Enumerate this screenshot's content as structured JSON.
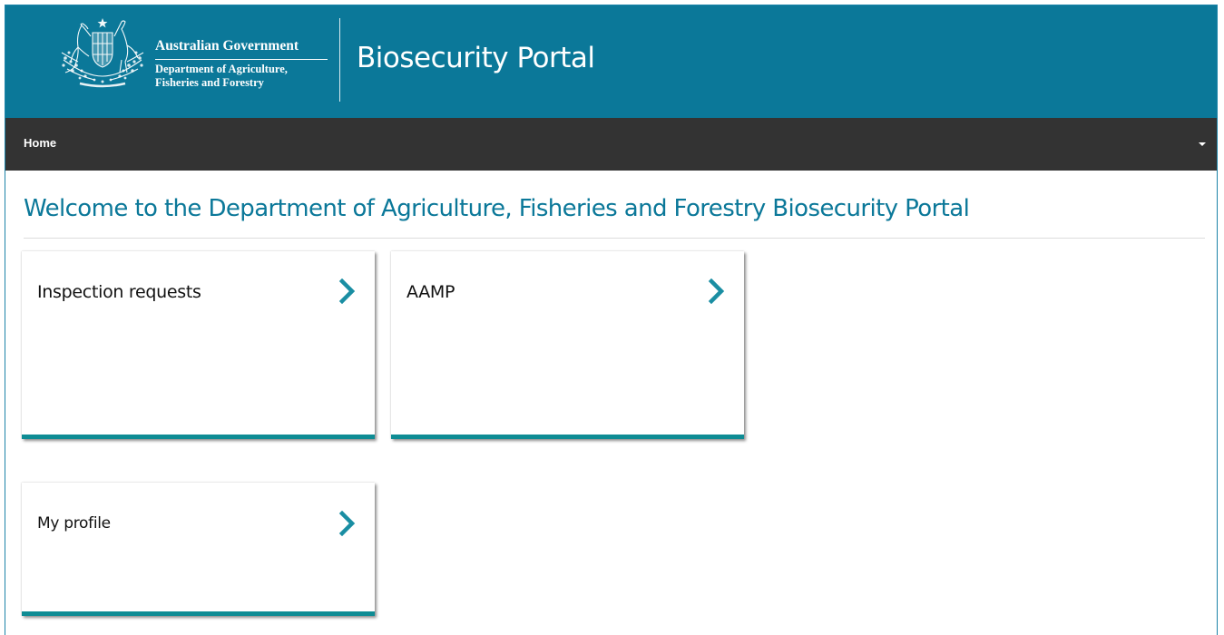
{
  "header": {
    "gov_name": "Australian Government",
    "dept_line1": "Department of Agriculture,",
    "dept_line2": "Fisheries and Forestry",
    "portal_title": "Biosecurity Portal",
    "crest_icon": "coat-of-arms-icon",
    "background_color": "#0b7899"
  },
  "nav": {
    "home_label": "Home",
    "menu_icon": "caret-down-icon",
    "background_color": "#333333"
  },
  "main": {
    "heading": "Welcome to the Department of Agriculture, Fisheries and Forestry Biosecurity Portal",
    "heading_color": "#0b7899",
    "tiles": [
      {
        "label": "Inspection requests",
        "icon": "chevron-right-icon"
      },
      {
        "label": "AAMP",
        "icon": "chevron-right-icon"
      },
      {
        "label": "My profile",
        "icon": "chevron-right-icon"
      }
    ],
    "tile_accent_color": "#0e8c94"
  }
}
